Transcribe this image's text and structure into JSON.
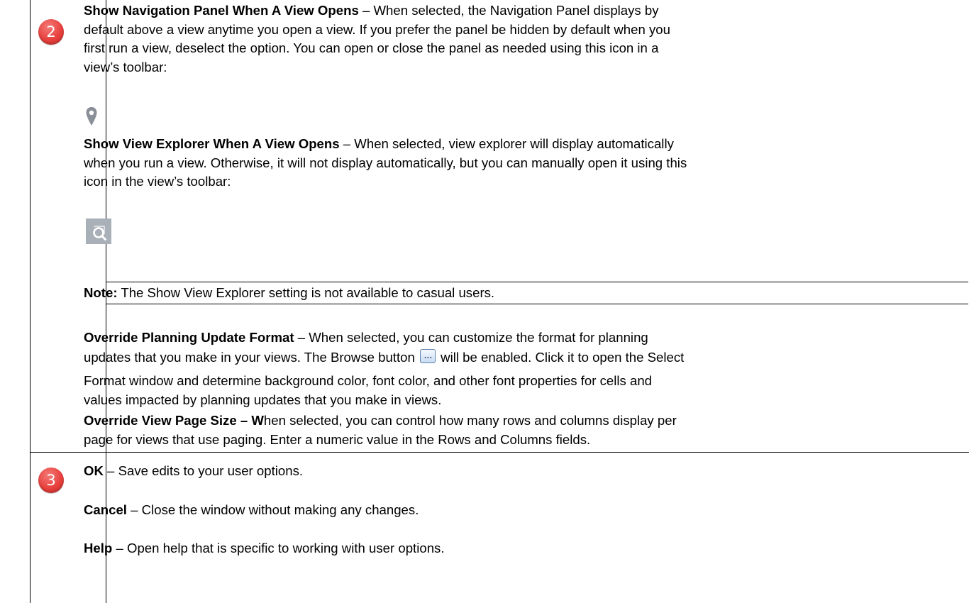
{
  "rows": [
    {
      "step": "2",
      "items": [
        {
          "title": "Show Navigation Panel When A View Opens",
          "sep": " – ",
          "lines": [
            "When selected, the Navigation Panel displays by",
            "default above a view anytime you open a view. If you prefer the panel be hidden by default when you",
            "first run a view, deselect the option. You can open or close the panel as needed using this icon in a",
            "view’s toolbar:"
          ],
          "icon": "map-pin-icon"
        },
        {
          "title": "Show View Explorer When A View Opens",
          "sep": " – ",
          "lines": [
            "When selected, view explorer will display automatically",
            "when you run a view. Otherwise, it will not display automatically, but you can manually open it using this",
            "icon in the view’s toolbar:"
          ],
          "icon": "view-explorer-icon"
        },
        {
          "note_label": "Note:",
          "note_text": " The Show View Explorer setting is not available to casual users."
        },
        {
          "title": "Override Planning Update Format",
          "sep": " – ",
          "line1": "When selected, you can customize the format for planning",
          "line2_before": "updates that you make in your views. The Browse button ",
          "line2_after": " will be enabled. Click it to open the Select",
          "lines_rest": [
            "Format window and determine background color, font color, and other font properties for cells and",
            "values impacted by planning updates that you make in views."
          ],
          "inline_icon": "browse-button-icon"
        },
        {
          "title": "Override View Page Size – W",
          "lines": [
            "hen selected, you can control how many rows and columns display per",
            "page for views that use paging. Enter a numeric value in the Rows and Columns fields."
          ]
        }
      ]
    },
    {
      "step": "3",
      "items": [
        {
          "title": "OK",
          "sep": " – ",
          "text": "Save edits to your user options."
        },
        {
          "title": "Cancel",
          "sep": " – ",
          "text": "Close the window without making any changes."
        },
        {
          "title": "Help",
          "sep": " – ",
          "text": "Open help that is specific to working with user options."
        }
      ]
    }
  ],
  "colors": {
    "badge": "#e8413e",
    "icon_gray": "#8a8f98",
    "text": "#000000",
    "border": "#000000"
  }
}
